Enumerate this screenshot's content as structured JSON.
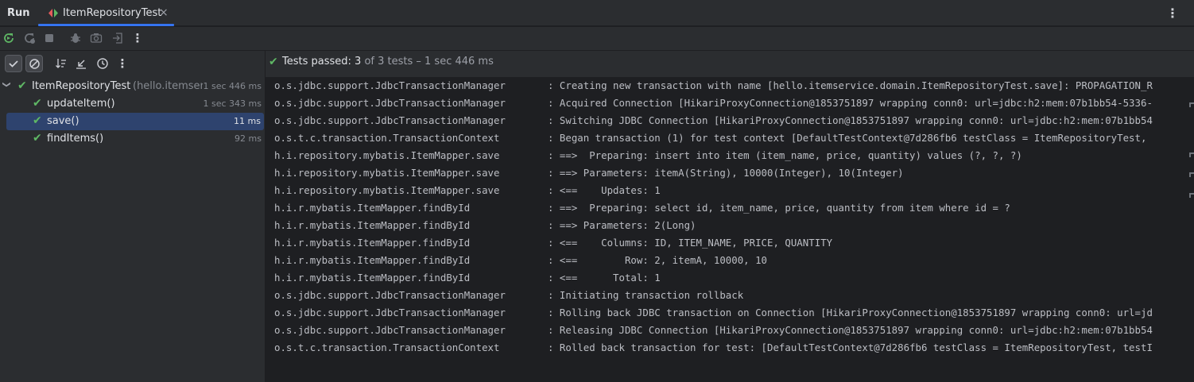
{
  "window": {
    "run_label": "Run",
    "tab_title": "ItemRepositoryTest",
    "tab_close": "×",
    "more_menu": "⋮"
  },
  "run_toolbar": {
    "more_menu": "⋮"
  },
  "test_toolbar": {
    "more_menu": "⋮"
  },
  "status": {
    "check": "✔",
    "prefix": "Tests passed: ",
    "passed": "3",
    "suffix": " of 3 tests – 1 sec 446 ms"
  },
  "tree": {
    "root": {
      "chevron": "❯",
      "name": "ItemRepositoryTest",
      "package": "(hello.itemser",
      "duration": "1 sec 446 ms"
    },
    "items": [
      {
        "name": "updateItem()",
        "duration": "1 sec 343 ms"
      },
      {
        "name": "save()",
        "duration": "11 ms"
      },
      {
        "name": "findItems()",
        "duration": "92 ms"
      }
    ],
    "check": "✔"
  },
  "console": {
    "lines": [
      {
        "logger": "o.s.jdbc.support.JdbcTransactionManager",
        "msg": ": Creating new transaction with name [hello.itemservice.domain.ItemRepositoryTest.save]: PROPAGATION_R"
      },
      {
        "logger": "o.s.jdbc.support.JdbcTransactionManager",
        "msg": ": Acquired Connection [HikariProxyConnection@1853751897 wrapping conn0: url=jdbc:h2:mem:07b1bb54-5336-"
      },
      {
        "logger": "o.s.jdbc.support.JdbcTransactionManager",
        "msg": ": Switching JDBC Connection [HikariProxyConnection@1853751897 wrapping conn0: url=jdbc:h2:mem:07b1bb54"
      },
      {
        "logger": "o.s.t.c.transaction.TransactionContext",
        "msg": ": Began transaction (1) for test context [DefaultTestContext@7d286fb6 testClass = ItemRepositoryTest, "
      },
      {
        "logger": "h.i.repository.mybatis.ItemMapper.save",
        "msg": ": ==>  Preparing: insert into item (item_name, price, quantity) values (?, ?, ?)"
      },
      {
        "logger": "h.i.repository.mybatis.ItemMapper.save",
        "msg": ": ==> Parameters: itemA(String), 10000(Integer), 10(Integer)"
      },
      {
        "logger": "h.i.repository.mybatis.ItemMapper.save",
        "msg": ": <==    Updates: 1"
      },
      {
        "logger": "h.i.r.mybatis.ItemMapper.findById",
        "msg": ": ==>  Preparing: select id, item_name, price, quantity from item where id = ?"
      },
      {
        "logger": "h.i.r.mybatis.ItemMapper.findById",
        "msg": ": ==> Parameters: 2(Long)"
      },
      {
        "logger": "h.i.r.mybatis.ItemMapper.findById",
        "msg": ": <==    Columns: ID, ITEM_NAME, PRICE, QUANTITY"
      },
      {
        "logger": "h.i.r.mybatis.ItemMapper.findById",
        "msg": ": <==        Row: 2, itemA, 10000, 10"
      },
      {
        "logger": "h.i.r.mybatis.ItemMapper.findById",
        "msg": ": <==      Total: 1"
      },
      {
        "logger": "o.s.jdbc.support.JdbcTransactionManager",
        "msg": ": Initiating transaction rollback"
      },
      {
        "logger": "o.s.jdbc.support.JdbcTransactionManager",
        "msg": ": Rolling back JDBC transaction on Connection [HikariProxyConnection@1853751897 wrapping conn0: url=jd"
      },
      {
        "logger": "o.s.jdbc.support.JdbcTransactionManager",
        "msg": ": Releasing JDBC Connection [HikariProxyConnection@1853751897 wrapping conn0: url=jdbc:h2:mem:07b1bb54"
      },
      {
        "logger": "o.s.t.c.transaction.TransactionContext",
        "msg": ": Rolled back transaction for test: [DefaultTestContext@7d286fb6 testClass = ItemRepositoryTest, testI"
      }
    ]
  },
  "colors": {
    "pass_green": "#5fb865",
    "accent_blue": "#3574f0",
    "selection": "#2e436e"
  },
  "icons": [
    "rerun-icon",
    "rerun-failed-icon",
    "stop-icon",
    "debug-icon",
    "screenshot-icon",
    "exit-icon",
    "filter-passed-icon",
    "filter-ignored-icon",
    "sort-icon",
    "collapse-icon",
    "history-icon"
  ]
}
